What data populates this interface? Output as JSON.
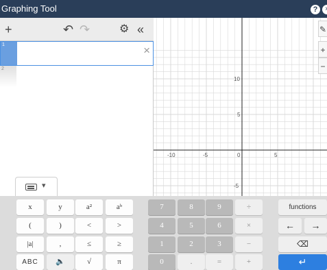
{
  "window": {
    "title": "Graphing Tool",
    "help_label": "?",
    "close_label": "×"
  },
  "toolbar": {
    "add_label": "+",
    "undo_label": "↶",
    "redo_label": "↷",
    "settings_label": "⚙",
    "collapse_label": "«"
  },
  "expressions": [
    {
      "index": "1",
      "value": "",
      "delete_label": "×"
    },
    {
      "index": "2",
      "value": ""
    }
  ],
  "keyboard_toggle": {
    "caret": "▾"
  },
  "graph": {
    "x_ticks": [
      "-10",
      "-5",
      "0",
      "5"
    ],
    "y_ticks": [
      "10",
      "5",
      "-5"
    ],
    "grid_color": "#d9d9d9",
    "axis_color": "#222222",
    "side_tools": [
      "✎",
      "+",
      "−"
    ]
  },
  "keypad": {
    "function_keys": [
      {
        "label": "x",
        "name": "key-x"
      },
      {
        "label": "y",
        "name": "key-y"
      },
      {
        "label": "a²",
        "name": "key-a-squared"
      },
      {
        "label": "aᵇ",
        "name": "key-a-power-b"
      },
      {
        "label": "(",
        "name": "key-left-paren"
      },
      {
        "label": ")",
        "name": "key-right-paren"
      },
      {
        "label": "<",
        "name": "key-less-than"
      },
      {
        "label": ">",
        "name": "key-greater-than"
      },
      {
        "label": "|a|",
        "name": "key-abs"
      },
      {
        "label": ",",
        "name": "key-comma"
      },
      {
        "label": "≤",
        "name": "key-less-equal"
      },
      {
        "label": "≥",
        "name": "key-greater-equal"
      },
      {
        "label": "ABC",
        "name": "key-abc"
      },
      {
        "label": "🔈",
        "name": "key-audio"
      },
      {
        "label": "√",
        "name": "key-sqrt"
      },
      {
        "label": "π",
        "name": "key-pi"
      }
    ],
    "number_keys": [
      {
        "label": "7",
        "name": "key-7"
      },
      {
        "label": "8",
        "name": "key-8"
      },
      {
        "label": "9",
        "name": "key-9"
      },
      {
        "label": "÷",
        "name": "key-divide"
      },
      {
        "label": "4",
        "name": "key-4"
      },
      {
        "label": "5",
        "name": "key-5"
      },
      {
        "label": "6",
        "name": "key-6"
      },
      {
        "label": "×",
        "name": "key-multiply"
      },
      {
        "label": "1",
        "name": "key-1"
      },
      {
        "label": "2",
        "name": "key-2"
      },
      {
        "label": "3",
        "name": "key-3"
      },
      {
        "label": "−",
        "name": "key-minus"
      },
      {
        "label": "0",
        "name": "key-0"
      },
      {
        "label": ".",
        "name": "key-decimal"
      },
      {
        "label": "=",
        "name": "key-equals"
      },
      {
        "label": "+",
        "name": "key-plus"
      }
    ],
    "functions_label": "functions",
    "left_arrow": "←",
    "right_arrow": "→",
    "backspace": "⌫",
    "enter": "↵"
  }
}
